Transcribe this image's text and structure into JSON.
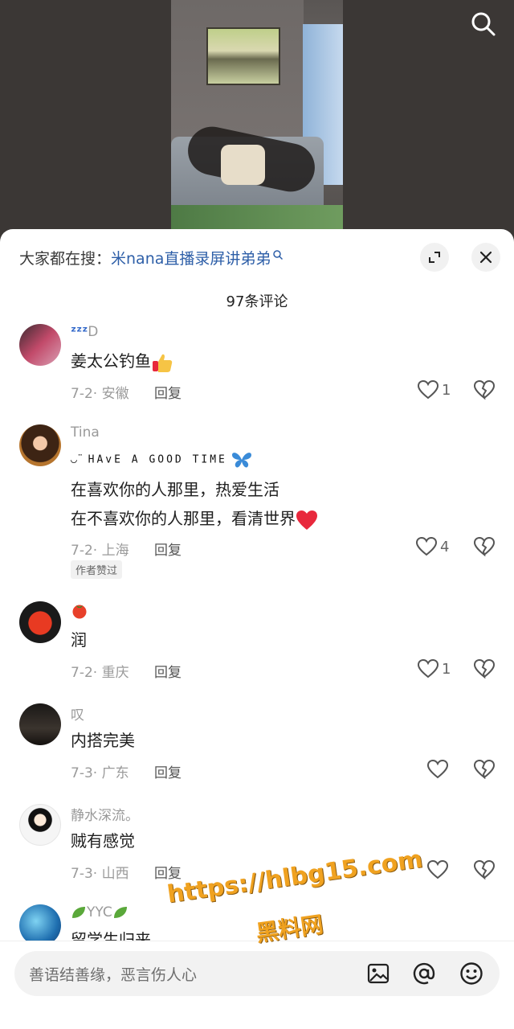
{
  "header": {
    "hot_search_prefix": "大家都在搜：",
    "hot_search_term": "米nana直播录屏讲弟弟",
    "comment_count_label": "97条评论"
  },
  "comments": [
    {
      "name": "D",
      "text": "姜太公钓鱼",
      "date": "7-2",
      "location": "安徽",
      "reply": "回复",
      "likes": "1"
    },
    {
      "name": "Tina",
      "motto": "HAvE A GOOD TIME",
      "line1": "在喜欢你的人那里，热爱生活",
      "line2": "在不喜欢你的人那里，看清世界",
      "date": "7-2",
      "location": "上海",
      "reply": "回复",
      "likes": "4",
      "badge": "作者赞过"
    },
    {
      "name": "",
      "text": "润",
      "date": "7-2",
      "location": "重庆",
      "reply": "回复",
      "likes": "1"
    },
    {
      "name": "叹",
      "text": "内搭完美",
      "date": "7-3",
      "location": "广东",
      "reply": "回复",
      "likes": ""
    },
    {
      "name": "静水深流。",
      "text": "贼有感觉",
      "date": "7-3",
      "location": "山西",
      "reply": "回复",
      "likes": ""
    },
    {
      "name": "YYC",
      "text": "留学生归来"
    }
  ],
  "input": {
    "placeholder": "善语结善缘，恶言伤人心"
  },
  "watermark": {
    "url": "https://hlbg15.com",
    "site": "黑料网"
  },
  "colors": {
    "link_blue": "#2e5fa8",
    "heart_red": "#e8283c",
    "watermark": "#f0a220"
  },
  "icons": [
    "search-icon",
    "expand-icon",
    "close-icon",
    "heart-icon",
    "broken-heart-icon",
    "image-icon",
    "at-icon",
    "emoji-icon"
  ]
}
